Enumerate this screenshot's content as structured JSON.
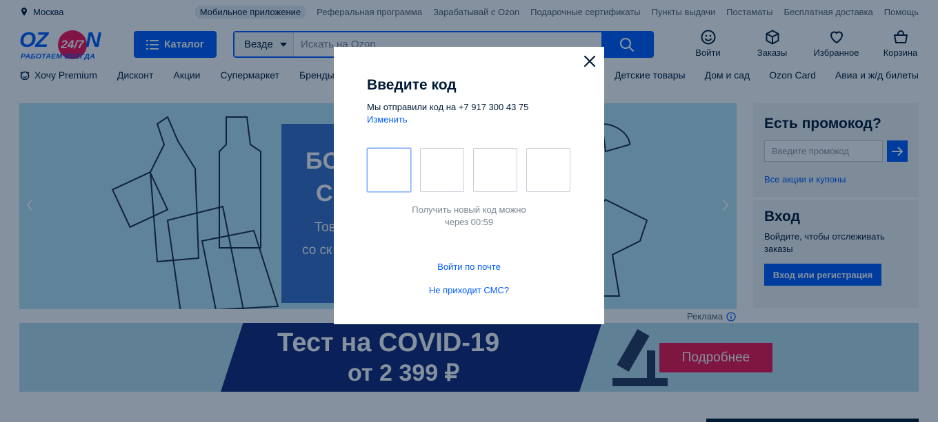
{
  "topbar": {
    "city": "Москва",
    "links": [
      "Мобильное приложение",
      "Реферальная программа",
      "Зарабатывай с Ozon",
      "Подарочные сертификаты",
      "Пункты выдачи",
      "Постаматы",
      "Бесплатная доставка",
      "Помощь"
    ]
  },
  "header": {
    "logo_text": "OZON",
    "logo_badge": "24/7",
    "logo_slogan": "РАБОТАЕМ ВСЕГДА",
    "catalog_label": "Каталог",
    "search_scope": "Везде",
    "search_placeholder": "Искать на Ozon",
    "icons": [
      {
        "label": "Войти",
        "icon": "smile-icon"
      },
      {
        "label": "Заказы",
        "icon": "box-icon"
      },
      {
        "label": "Избранное",
        "icon": "heart-icon"
      },
      {
        "label": "Корзина",
        "icon": "cart-icon"
      }
    ]
  },
  "nav": {
    "left": [
      "Хочу Premium",
      "Дисконт",
      "Акции",
      "Супермаркет",
      "Бренды"
    ],
    "right": [
      "Детские товары",
      "Дом и сад",
      "Ozon Card",
      "Авиа и ж/д билеты"
    ]
  },
  "banner": {
    "text_line1": "БО",
    "text_line2": "С",
    "text_line3": "Тов",
    "text_line4": "со ск"
  },
  "promo": {
    "title": "Есть промокод?",
    "placeholder": "Введите промокод",
    "link": "Все акции и купоны"
  },
  "login": {
    "title": "Вход",
    "text": "Войдите, чтобы отслеживать заказы",
    "button": "Вход или регистрация"
  },
  "ad_label": "Реклама",
  "covid": {
    "line1": "Тест на COVID-19",
    "line2": "от 2 399 ₽",
    "button": "Подробнее"
  },
  "modal": {
    "title": "Введите код",
    "sent_text": "Мы отправили код на +7 917 300 43 75",
    "change_link": "Изменить",
    "timer_line1": "Получить новый код можно",
    "timer_line2": "через 00:59",
    "email_link": "Войти по почте",
    "nosms_link": "Не приходит СМС?"
  }
}
